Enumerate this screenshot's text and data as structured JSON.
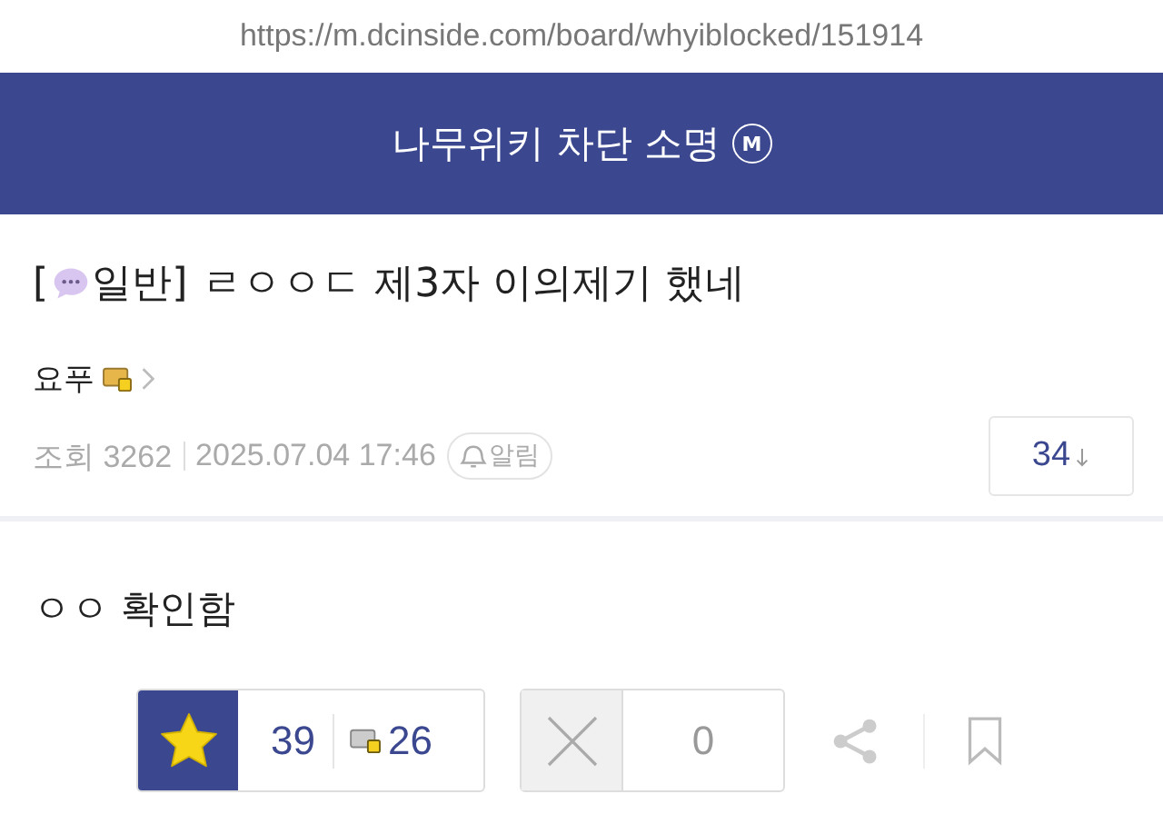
{
  "url": "https://m.dcinside.com/board/whyiblocked/151914",
  "header": {
    "title": "나무위키 차단 소명",
    "badge": "M"
  },
  "post": {
    "bracket_open": "[",
    "category": "일반]",
    "subject": "ㄹㅇㅇㄷ 제3자 이의제기 했네",
    "author": "요푸",
    "views": "조회 3262",
    "date": "2025.07.04 17:46",
    "alert": "알림",
    "comments": "34",
    "body": "ㅇㅇ 확인함"
  },
  "votes": {
    "up": "39",
    "fixed_up": "26",
    "down": "0"
  }
}
